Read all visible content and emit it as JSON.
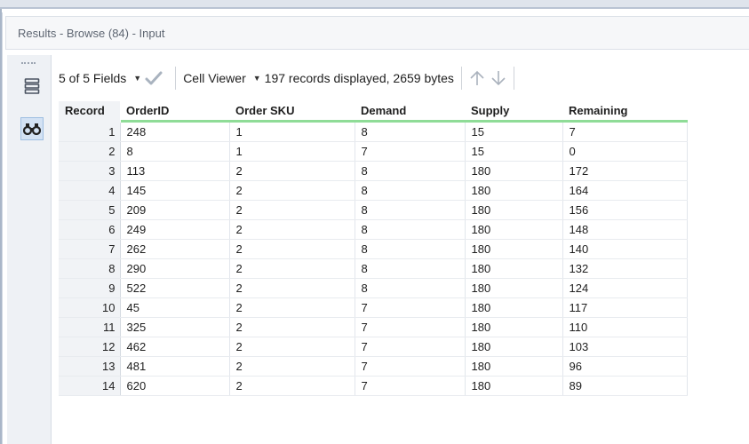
{
  "window": {
    "title": "Results - Browse (84) - Input"
  },
  "toolbar": {
    "fields_label": "5 of 5 Fields",
    "viewer_label": "Cell Viewer",
    "status": "197 records displayed, 2659 bytes"
  },
  "icons": {
    "fields_dropdown": "caret-down-icon",
    "check": "checkmark-icon",
    "viewer_dropdown": "caret-down-icon",
    "up": "arrow-up-icon",
    "down": "arrow-down-icon",
    "rail_list": "list-view-icon",
    "rail_browse": "binoculars-icon"
  },
  "colors": {
    "header_underline": "#8fdc97",
    "check": "#a9b3bf",
    "accent": "#2d6fb6"
  },
  "table": {
    "columns": [
      "Record",
      "OrderID",
      "Order SKU",
      "Demand",
      "Supply",
      "Remaining"
    ],
    "rows": [
      [
        "1",
        "248",
        "1",
        "8",
        "15",
        "7"
      ],
      [
        "2",
        "8",
        "1",
        "7",
        "15",
        "0"
      ],
      [
        "3",
        "113",
        "2",
        "8",
        "180",
        "172"
      ],
      [
        "4",
        "145",
        "2",
        "8",
        "180",
        "164"
      ],
      [
        "5",
        "209",
        "2",
        "8",
        "180",
        "156"
      ],
      [
        "6",
        "249",
        "2",
        "8",
        "180",
        "148"
      ],
      [
        "7",
        "262",
        "2",
        "8",
        "180",
        "140"
      ],
      [
        "8",
        "290",
        "2",
        "8",
        "180",
        "132"
      ],
      [
        "9",
        "522",
        "2",
        "8",
        "180",
        "124"
      ],
      [
        "10",
        "45",
        "2",
        "7",
        "180",
        "117"
      ],
      [
        "11",
        "325",
        "2",
        "7",
        "180",
        "110"
      ],
      [
        "12",
        "462",
        "2",
        "7",
        "180",
        "103"
      ],
      [
        "13",
        "481",
        "2",
        "7",
        "180",
        "96"
      ],
      [
        "14",
        "620",
        "2",
        "7",
        "180",
        "89"
      ]
    ]
  }
}
